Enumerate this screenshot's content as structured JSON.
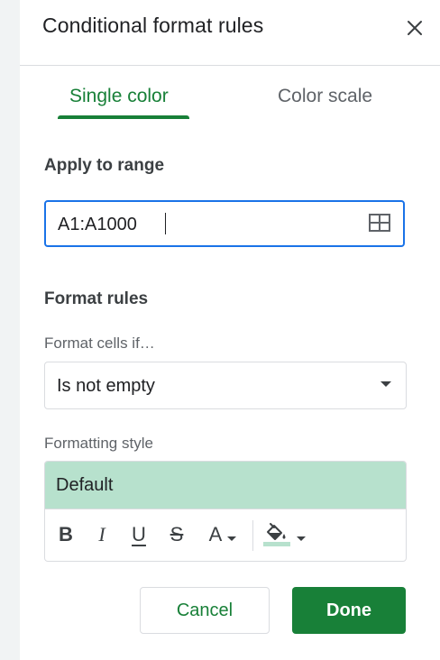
{
  "panel": {
    "title": "Conditional format rules",
    "close_icon": "close-icon"
  },
  "tabs": [
    {
      "label": "Single color",
      "selected": true
    },
    {
      "label": "Color scale",
      "selected": false
    }
  ],
  "apply_to_range": {
    "heading": "Apply to range",
    "value": "A1:A1000",
    "icon": "grid-select-icon"
  },
  "format_rules": {
    "heading": "Format rules",
    "condition_label": "Format cells if…",
    "condition_value": "Is not empty",
    "style_label": "Formatting style",
    "style_preview": "Default",
    "preview_color": "#b7e1cd",
    "toolbar": {
      "bold": "B",
      "italic": "I",
      "underline": "U",
      "strikethrough": "S",
      "text_color": "A",
      "fill_color_swatch": "#b7e1cd"
    }
  },
  "actions": {
    "cancel_label": "Cancel",
    "done_label": "Done"
  },
  "colors": {
    "accent": "#188038",
    "focus": "#1a73e8"
  }
}
